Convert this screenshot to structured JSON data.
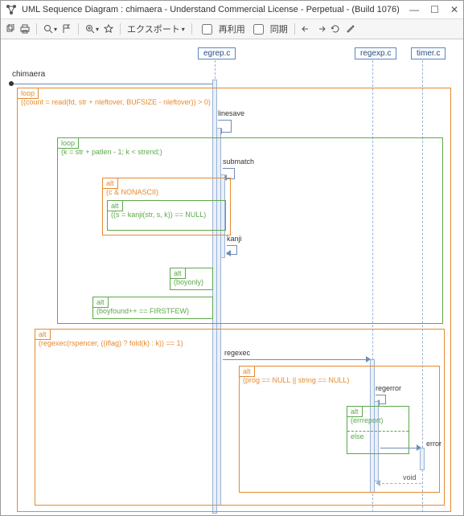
{
  "window": {
    "title": "UML Sequence Diagram : chimaera - Understand Commercial License - Perpetual - (Build 1076)"
  },
  "toolbar": {
    "export": "エクスポート",
    "reuse": "再利用",
    "sync": "同期"
  },
  "lifelines": {
    "egrep": "egrep.c",
    "regexp": "regexp.c",
    "timer": "timer.c"
  },
  "actor": "chimaera",
  "frames": {
    "loop1": {
      "tag": "loop",
      "guard": "((count = read(fd, str + nleftover, BUFSIZE - nleftover)) > 0)"
    },
    "loop2": {
      "tag": "loop",
      "guard": "(k = str + patlen - 1; k < strend;)"
    },
    "alt_nonascii": {
      "tag": "alt",
      "guard": "(c & NONASCII)"
    },
    "alt_kanji": {
      "tag": "alt",
      "guard": "((s = kanji(str, s, k)) == NULL)"
    },
    "alt_boyonly": {
      "tag": "alt",
      "guard": "(boyonly)"
    },
    "alt_boyfound": {
      "tag": "alt",
      "guard": "(boyfound++ == FIRSTFEW)"
    },
    "alt_regexec": {
      "tag": "alt",
      "guard": "(regexec(rspencer, ((iflag) ? fold(k) : k)) == 1)"
    },
    "alt_prognull": {
      "tag": "alt",
      "guard": "(prog == NULL || string == NULL)"
    },
    "alt_errreport": {
      "tag": "alt",
      "guard": "(errreport)",
      "else": "else"
    }
  },
  "messages": {
    "linesave": "linesave",
    "submatch": "submatch",
    "kanji": "kanji",
    "regexec": "regexec",
    "regerror": "regerror",
    "error": "error"
  },
  "returns": {
    "void": "void"
  }
}
